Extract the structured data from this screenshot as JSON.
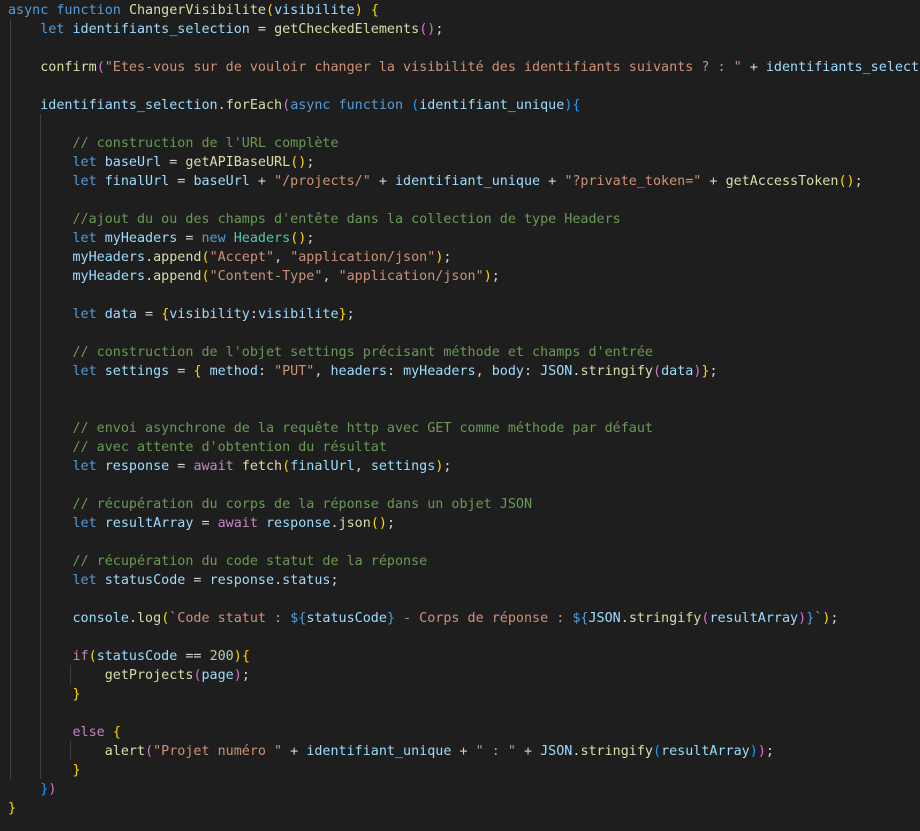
{
  "editor": {
    "language": "javascript",
    "theme": "dark",
    "colors": {
      "background": "#1e1e1e",
      "keyword": "#569cd6",
      "control": "#c586c0",
      "function": "#dcdcaa",
      "variable": "#9cdcfe",
      "class": "#4ec9b0",
      "string": "#ce9178",
      "number": "#b5cea8",
      "comment": "#6a9955",
      "bracket_level_1": "#ffd700",
      "bracket_level_2": "#da70d6",
      "bracket_level_3": "#179fff"
    },
    "lines": [
      [
        [
          "kw",
          "async"
        ],
        [
          "pun",
          " "
        ],
        [
          "kw",
          "function"
        ],
        [
          "pun",
          " "
        ],
        [
          "fn",
          "ChangerVisibilite"
        ],
        [
          "b1",
          "("
        ],
        [
          "var",
          "visibilite"
        ],
        [
          "b1",
          ")"
        ],
        [
          "pun",
          " "
        ],
        [
          "b1",
          "{"
        ]
      ],
      [
        [
          "pun",
          "    "
        ],
        [
          "kw",
          "let"
        ],
        [
          "pun",
          " "
        ],
        [
          "var",
          "identifiants_selection"
        ],
        [
          "pun",
          " = "
        ],
        [
          "fn",
          "getCheckedElements"
        ],
        [
          "b2",
          "()"
        ],
        [
          "pun",
          ";"
        ]
      ],
      [],
      [
        [
          "pun",
          "    "
        ],
        [
          "fn",
          "confirm"
        ],
        [
          "b2",
          "("
        ],
        [
          "str",
          "\"Etes-vous sur de vouloir changer la visibilité des identifiants suivants ? : \""
        ],
        [
          "pun",
          " + "
        ],
        [
          "var",
          "identifiants_selection"
        ],
        [
          "b2",
          ")"
        ],
        [
          "pun",
          ";"
        ]
      ],
      [],
      [
        [
          "pun",
          "    "
        ],
        [
          "var",
          "identifiants_selection"
        ],
        [
          "pun",
          "."
        ],
        [
          "fn",
          "forEach"
        ],
        [
          "b2",
          "("
        ],
        [
          "kw",
          "async"
        ],
        [
          "pun",
          " "
        ],
        [
          "kw",
          "function"
        ],
        [
          "pun",
          " "
        ],
        [
          "b3",
          "("
        ],
        [
          "var",
          "identifiant_unique"
        ],
        [
          "b3",
          ")"
        ],
        [
          "b3",
          "{"
        ]
      ],
      [],
      [
        [
          "pun",
          "        "
        ],
        [
          "cmt",
          "// construction de l'URL complète"
        ]
      ],
      [
        [
          "pun",
          "        "
        ],
        [
          "kw",
          "let"
        ],
        [
          "pun",
          " "
        ],
        [
          "var",
          "baseUrl"
        ],
        [
          "pun",
          " = "
        ],
        [
          "fn",
          "getAPIBaseURL"
        ],
        [
          "b1",
          "()"
        ],
        [
          "pun",
          ";"
        ]
      ],
      [
        [
          "pun",
          "        "
        ],
        [
          "kw",
          "let"
        ],
        [
          "pun",
          " "
        ],
        [
          "var",
          "finalUrl"
        ],
        [
          "pun",
          " = "
        ],
        [
          "var",
          "baseUrl"
        ],
        [
          "pun",
          " + "
        ],
        [
          "str",
          "\"/projects/\""
        ],
        [
          "pun",
          " + "
        ],
        [
          "var",
          "identifiant_unique"
        ],
        [
          "pun",
          " + "
        ],
        [
          "str",
          "\"?private_token=\""
        ],
        [
          "pun",
          " + "
        ],
        [
          "fn",
          "getAccessToken"
        ],
        [
          "b1",
          "()"
        ],
        [
          "pun",
          ";"
        ]
      ],
      [],
      [
        [
          "pun",
          "        "
        ],
        [
          "cmt",
          "//ajout du ou des champs d'entête dans la collection de type Headers"
        ]
      ],
      [
        [
          "pun",
          "        "
        ],
        [
          "kw",
          "let"
        ],
        [
          "pun",
          " "
        ],
        [
          "var",
          "myHeaders"
        ],
        [
          "pun",
          " = "
        ],
        [
          "kw",
          "new"
        ],
        [
          "pun",
          " "
        ],
        [
          "cls",
          "Headers"
        ],
        [
          "b1",
          "()"
        ],
        [
          "pun",
          ";"
        ]
      ],
      [
        [
          "pun",
          "        "
        ],
        [
          "var",
          "myHeaders"
        ],
        [
          "pun",
          "."
        ],
        [
          "fn",
          "append"
        ],
        [
          "b1",
          "("
        ],
        [
          "str",
          "\"Accept\""
        ],
        [
          "pun",
          ", "
        ],
        [
          "str",
          "\"application/json\""
        ],
        [
          "b1",
          ")"
        ],
        [
          "pun",
          ";"
        ]
      ],
      [
        [
          "pun",
          "        "
        ],
        [
          "var",
          "myHeaders"
        ],
        [
          "pun",
          "."
        ],
        [
          "fn",
          "append"
        ],
        [
          "b1",
          "("
        ],
        [
          "str",
          "\"Content-Type\""
        ],
        [
          "pun",
          ", "
        ],
        [
          "str",
          "\"application/json\""
        ],
        [
          "b1",
          ")"
        ],
        [
          "pun",
          ";"
        ]
      ],
      [],
      [
        [
          "pun",
          "        "
        ],
        [
          "kw",
          "let"
        ],
        [
          "pun",
          " "
        ],
        [
          "var",
          "data"
        ],
        [
          "pun",
          " = "
        ],
        [
          "b1",
          "{"
        ],
        [
          "var",
          "visibility"
        ],
        [
          "pun",
          ":"
        ],
        [
          "var",
          "visibilite"
        ],
        [
          "b1",
          "}"
        ],
        [
          "pun",
          ";"
        ]
      ],
      [],
      [
        [
          "pun",
          "        "
        ],
        [
          "cmt",
          "// construction de l'objet settings précisant méthode et champs d'entrée"
        ]
      ],
      [
        [
          "pun",
          "        "
        ],
        [
          "kw",
          "let"
        ],
        [
          "pun",
          " "
        ],
        [
          "var",
          "settings"
        ],
        [
          "pun",
          " = "
        ],
        [
          "b1",
          "{"
        ],
        [
          "pun",
          " "
        ],
        [
          "var",
          "method"
        ],
        [
          "pun",
          ": "
        ],
        [
          "str",
          "\"PUT\""
        ],
        [
          "pun",
          ", "
        ],
        [
          "var",
          "headers"
        ],
        [
          "pun",
          ": "
        ],
        [
          "var",
          "myHeaders"
        ],
        [
          "pun",
          ", "
        ],
        [
          "var",
          "body"
        ],
        [
          "pun",
          ": "
        ],
        [
          "var",
          "JSON"
        ],
        [
          "pun",
          "."
        ],
        [
          "fn",
          "stringify"
        ],
        [
          "b2",
          "("
        ],
        [
          "var",
          "data"
        ],
        [
          "b2",
          ")"
        ],
        [
          "b1",
          "}"
        ],
        [
          "pun",
          ";"
        ]
      ],
      [],
      [],
      [
        [
          "pun",
          "        "
        ],
        [
          "cmt",
          "// envoi asynchrone de la requête http avec GET comme méthode par défaut"
        ]
      ],
      [
        [
          "pun",
          "        "
        ],
        [
          "cmt",
          "// avec attente d'obtention du résultat"
        ]
      ],
      [
        [
          "pun",
          "        "
        ],
        [
          "kw",
          "let"
        ],
        [
          "pun",
          " "
        ],
        [
          "var",
          "response"
        ],
        [
          "pun",
          " = "
        ],
        [
          "ctl",
          "await"
        ],
        [
          "pun",
          " "
        ],
        [
          "fn",
          "fetch"
        ],
        [
          "b1",
          "("
        ],
        [
          "var",
          "finalUrl"
        ],
        [
          "pun",
          ", "
        ],
        [
          "var",
          "settings"
        ],
        [
          "b1",
          ")"
        ],
        [
          "pun",
          ";"
        ]
      ],
      [],
      [
        [
          "pun",
          "        "
        ],
        [
          "cmt",
          "// récupération du corps de la réponse dans un objet JSON"
        ]
      ],
      [
        [
          "pun",
          "        "
        ],
        [
          "kw",
          "let"
        ],
        [
          "pun",
          " "
        ],
        [
          "var",
          "resultArray"
        ],
        [
          "pun",
          " = "
        ],
        [
          "ctl",
          "await"
        ],
        [
          "pun",
          " "
        ],
        [
          "var",
          "response"
        ],
        [
          "pun",
          "."
        ],
        [
          "fn",
          "json"
        ],
        [
          "b1",
          "()"
        ],
        [
          "pun",
          ";"
        ]
      ],
      [],
      [
        [
          "pun",
          "        "
        ],
        [
          "cmt",
          "// récupération du code statut de la réponse"
        ]
      ],
      [
        [
          "pun",
          "        "
        ],
        [
          "kw",
          "let"
        ],
        [
          "pun",
          " "
        ],
        [
          "var",
          "statusCode"
        ],
        [
          "pun",
          " = "
        ],
        [
          "var",
          "response"
        ],
        [
          "pun",
          "."
        ],
        [
          "var",
          "status"
        ],
        [
          "pun",
          ";"
        ]
      ],
      [],
      [
        [
          "pun",
          "        "
        ],
        [
          "var",
          "console"
        ],
        [
          "pun",
          "."
        ],
        [
          "fn",
          "log"
        ],
        [
          "b1",
          "("
        ],
        [
          "str",
          "`Code statut : "
        ],
        [
          "tpl",
          "${"
        ],
        [
          "var",
          "statusCode"
        ],
        [
          "tpl",
          "}"
        ],
        [
          "str",
          " - Corps de réponse : "
        ],
        [
          "tpl",
          "${"
        ],
        [
          "var",
          "JSON"
        ],
        [
          "pun",
          "."
        ],
        [
          "fn",
          "stringify"
        ],
        [
          "b2",
          "("
        ],
        [
          "var",
          "resultArray"
        ],
        [
          "b2",
          ")"
        ],
        [
          "tpl",
          "}"
        ],
        [
          "str",
          "`"
        ],
        [
          "b1",
          ")"
        ],
        [
          "pun",
          ";"
        ]
      ],
      [],
      [
        [
          "pun",
          "        "
        ],
        [
          "ctl",
          "if"
        ],
        [
          "b1",
          "("
        ],
        [
          "var",
          "statusCode"
        ],
        [
          "pun",
          " == "
        ],
        [
          "num",
          "200"
        ],
        [
          "b1",
          ")"
        ],
        [
          "b1",
          "{"
        ]
      ],
      [
        [
          "pun",
          "            "
        ],
        [
          "fn",
          "getProjects"
        ],
        [
          "b2",
          "("
        ],
        [
          "var",
          "page"
        ],
        [
          "b2",
          ")"
        ],
        [
          "pun",
          ";"
        ]
      ],
      [
        [
          "pun",
          "        "
        ],
        [
          "b1",
          "}"
        ]
      ],
      [],
      [
        [
          "pun",
          "        "
        ],
        [
          "ctl",
          "else"
        ],
        [
          "pun",
          " "
        ],
        [
          "b1",
          "{"
        ]
      ],
      [
        [
          "pun",
          "            "
        ],
        [
          "fn",
          "alert"
        ],
        [
          "b2",
          "("
        ],
        [
          "str",
          "\"Projet numéro \""
        ],
        [
          "pun",
          " + "
        ],
        [
          "var",
          "identifiant_unique"
        ],
        [
          "pun",
          " + "
        ],
        [
          "str",
          "\" : \""
        ],
        [
          "pun",
          " + "
        ],
        [
          "var",
          "JSON"
        ],
        [
          "pun",
          "."
        ],
        [
          "fn",
          "stringify"
        ],
        [
          "b3",
          "("
        ],
        [
          "var",
          "resultArray"
        ],
        [
          "b3",
          ")"
        ],
        [
          "b2",
          ")"
        ],
        [
          "pun",
          ";"
        ]
      ],
      [
        [
          "pun",
          "        "
        ],
        [
          "b1",
          "}"
        ]
      ],
      [
        [
          "pun",
          "    "
        ],
        [
          "b3",
          "}"
        ],
        [
          "b2",
          ")"
        ]
      ],
      [
        [
          "b1",
          "}"
        ]
      ]
    ]
  }
}
